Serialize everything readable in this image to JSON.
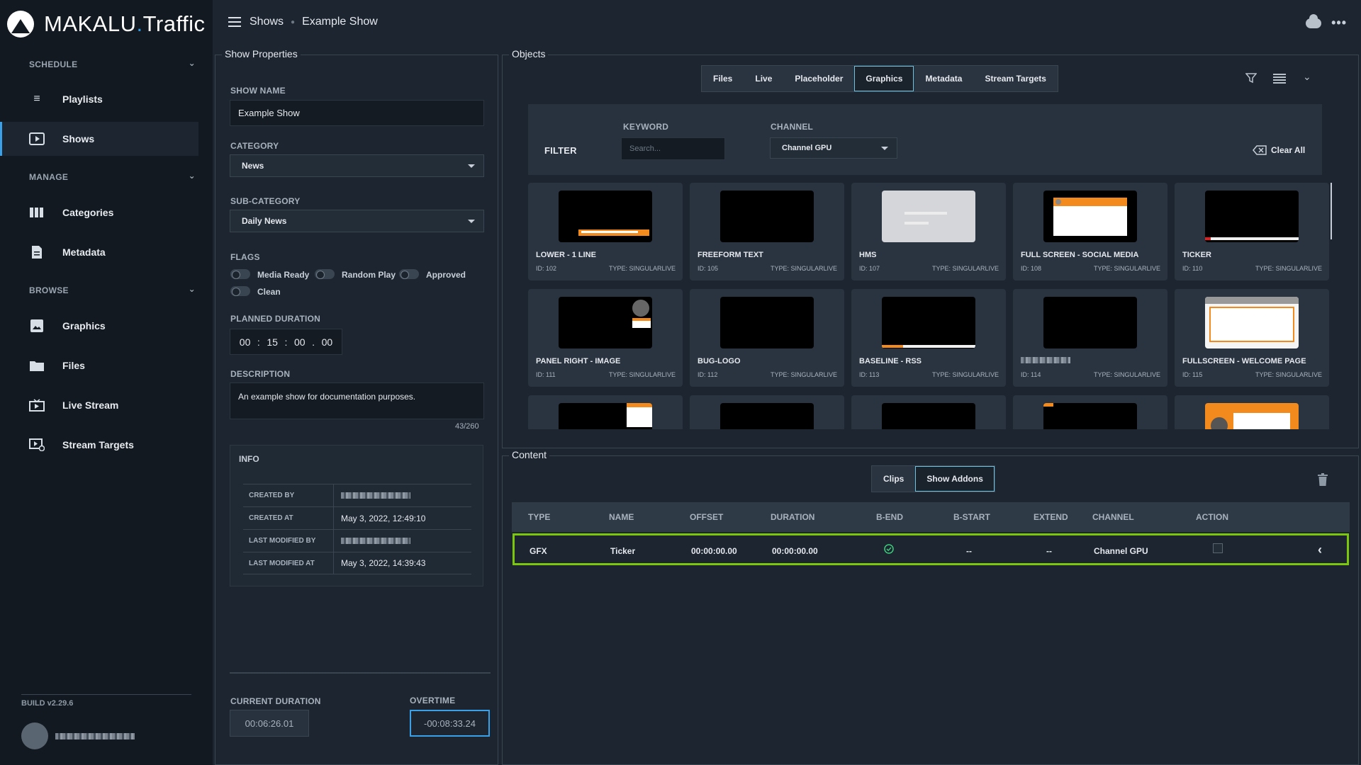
{
  "app": {
    "brand_main": "MAKALU",
    "brand_dot": ".",
    "brand_sub": "Traffic"
  },
  "breadcrumb": {
    "root": "Shows",
    "current": "Example Show"
  },
  "sidebar": {
    "schedule_title": "SCHEDULE",
    "manage_title": "MANAGE",
    "browse_title": "BROWSE",
    "items": [
      {
        "label": "Playlists",
        "icon": "playlist-icon"
      },
      {
        "label": "Shows",
        "icon": "play-screen-icon",
        "active": true
      },
      {
        "label": "Categories",
        "icon": "columns-icon"
      },
      {
        "label": "Metadata",
        "icon": "document-icon"
      },
      {
        "label": "Graphics",
        "icon": "image-icon"
      },
      {
        "label": "Files",
        "icon": "folder-icon"
      },
      {
        "label": "Live Stream",
        "icon": "live-stream-icon"
      },
      {
        "label": "Stream Targets",
        "icon": "stream-target-icon"
      }
    ],
    "build": "BUILD v2.29.6"
  },
  "show_properties": {
    "title": "Show Properties",
    "show_name_label": "SHOW NAME",
    "show_name": "Example Show",
    "category_label": "CATEGORY",
    "category": "News",
    "subcategory_label": "SUB-CATEGORY",
    "subcategory": "Daily News",
    "flags_label": "FLAGS",
    "flags": [
      "Media Ready",
      "Random Play",
      "Approved",
      "Clean"
    ],
    "planned_label": "PLANNED DURATION",
    "planned": {
      "h": "00",
      "m": "15",
      "s": "00",
      "f": "00"
    },
    "description_label": "DESCRIPTION",
    "description": "An example show for documentation purposes.",
    "char_count": "43/260",
    "info_title": "INFO",
    "info": [
      {
        "key": "CREATED BY",
        "value": ""
      },
      {
        "key": "CREATED AT",
        "value": "May 3, 2022, 12:49:10"
      },
      {
        "key": "LAST MODIFIED BY",
        "value": ""
      },
      {
        "key": "LAST MODIFIED AT",
        "value": "May 3, 2022, 14:39:43"
      }
    ],
    "current_duration_label": "CURRENT DURATION",
    "current_duration": "00:06:26.01",
    "overtime_label": "OVERTIME",
    "overtime": "-00:08:33.24"
  },
  "objects": {
    "title": "Objects",
    "tabs": [
      "Files",
      "Live",
      "Placeholder",
      "Graphics",
      "Metadata",
      "Stream Targets"
    ],
    "active_tab": "Graphics",
    "filter_label": "FILTER",
    "keyword_label": "KEYWORD",
    "keyword_placeholder": "Search...",
    "channel_label": "CHANNEL",
    "channel": "Channel GPU",
    "clear_all": "Clear All",
    "cards": [
      {
        "name": "LOWER - 1 LINE",
        "id": "ID: 102",
        "type": "TYPE: SINGULARLIVE"
      },
      {
        "name": "FREEFORM TEXT",
        "id": "ID: 105",
        "type": "TYPE: SINGULARLIVE"
      },
      {
        "name": "HMS",
        "id": "ID: 107",
        "type": "TYPE: SINGULARLIVE"
      },
      {
        "name": "FULL SCREEN - SOCIAL MEDIA",
        "id": "ID: 108",
        "type": "TYPE: SINGULARLIVE"
      },
      {
        "name": "TICKER",
        "id": "ID: 110",
        "type": "TYPE: SINGULARLIVE"
      },
      {
        "name": "PANEL RIGHT - IMAGE",
        "id": "ID: 111",
        "type": "TYPE: SINGULARLIVE"
      },
      {
        "name": "BUG-LOGO",
        "id": "ID: 112",
        "type": "TYPE: SINGULARLIVE"
      },
      {
        "name": "BASELINE - RSS",
        "id": "ID: 113",
        "type": "TYPE: SINGULARLIVE"
      },
      {
        "name": "",
        "id": "ID: 114",
        "type": "TYPE: SINGULARLIVE"
      },
      {
        "name": "FULLSCREEN - WELCOME PAGE",
        "id": "ID: 115",
        "type": "TYPE: SINGULARLIVE"
      }
    ]
  },
  "content": {
    "title": "Content",
    "tabs": [
      "Clips",
      "Show Addons"
    ],
    "active_tab": "Show Addons",
    "columns": [
      "TYPE",
      "NAME",
      "OFFSET",
      "DURATION",
      "B-END",
      "B-START",
      "EXTEND",
      "CHANNEL",
      "ACTION"
    ],
    "rows": [
      {
        "type": "GFX",
        "name": "Ticker",
        "offset": "00:00:00.00",
        "duration": "00:00:00.00",
        "b_start": "--",
        "extend": "--",
        "channel": "Channel GPU"
      }
    ]
  },
  "colors": {
    "accent": "#3aa0e8",
    "highlight_row": "#7ac70c",
    "orange": "#f28a1e"
  }
}
